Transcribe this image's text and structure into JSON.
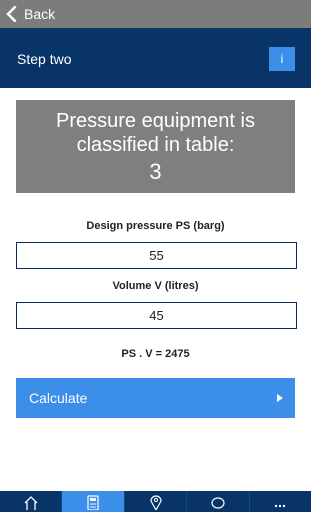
{
  "topbar": {
    "back_label": "Back"
  },
  "header": {
    "title": "Step two",
    "info_label": "i"
  },
  "result": {
    "line1": "Pressure equipment is",
    "line2": "classified in table:",
    "value": "3"
  },
  "form": {
    "pressure_label": "Design pressure PS (barg)",
    "pressure_value": "55",
    "volume_label": "Volume V (litres)",
    "volume_value": "45",
    "product_text": "PS . V = 2475"
  },
  "calculate": {
    "label": "Calculate"
  },
  "tabs": [
    {
      "icon": "home-icon"
    },
    {
      "icon": "calculator-icon",
      "active": true
    },
    {
      "icon": "location-pin-icon"
    },
    {
      "icon": "chat-bubble-icon"
    },
    {
      "icon": "more-icon"
    }
  ],
  "colors": {
    "navy": "#083467",
    "accent": "#3b8fe8",
    "grey": "#7f7f7f"
  }
}
